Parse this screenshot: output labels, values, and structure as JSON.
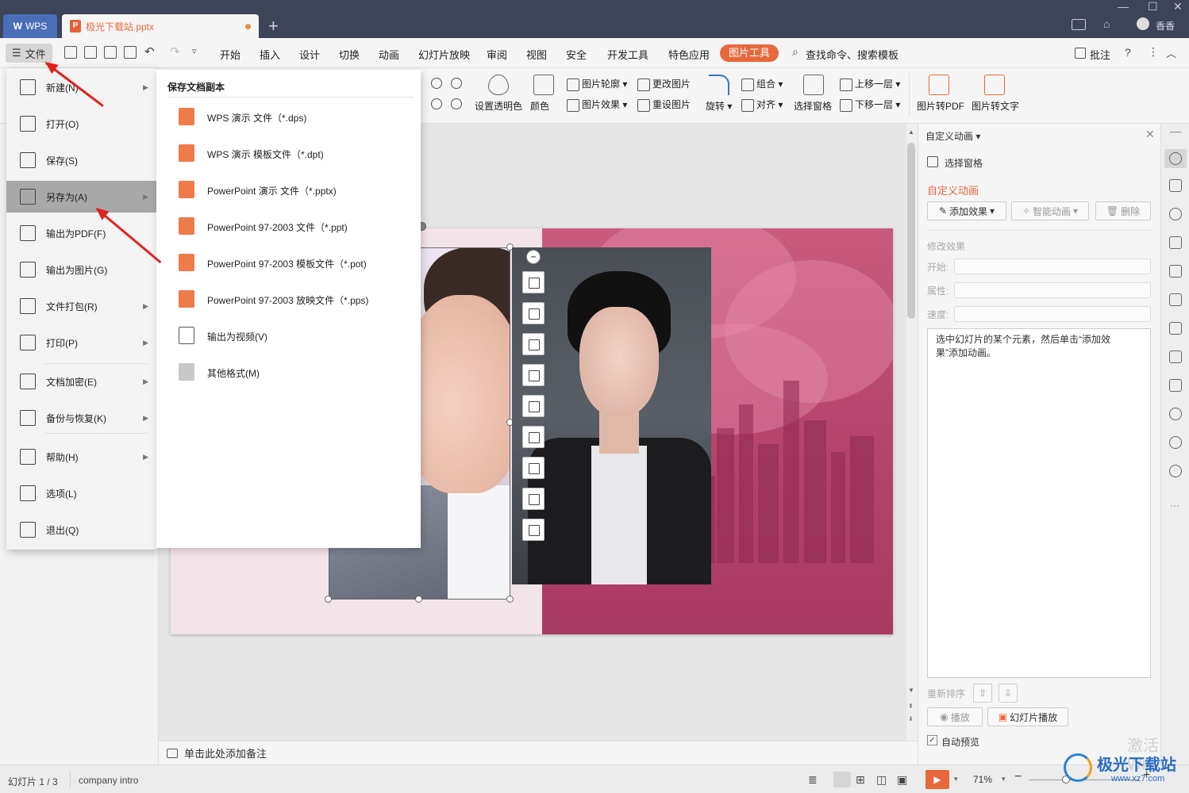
{
  "titlebar": {
    "app_tab": "WPS",
    "doc_tab": "极光下载站.pptx",
    "user": "香香"
  },
  "menubar": {
    "file": "文件",
    "items": [
      "开始",
      "插入",
      "设计",
      "切换",
      "动画",
      "幻灯片放映",
      "审阅",
      "视图",
      "安全",
      "开发工具",
      "特色应用"
    ],
    "active_tool_tab": "图片工具",
    "search": "查找命令、搜索模板",
    "comment": "批注"
  },
  "ribbon": {
    "set_transparent": "设置透明色",
    "color": "颜色",
    "picture_outline": "图片轮廓",
    "picture_effect": "图片效果",
    "change_picture": "更改图片",
    "reset_picture": "重设图片",
    "rotate": "旋转",
    "group": "组合",
    "align": "对齐",
    "select_pane": "选择窗格",
    "bring_forward": "上移一层",
    "send_backward": "下移一层",
    "pic_to_pdf": "图片转PDF",
    "pic_to_text": "图片转文字"
  },
  "file_menu": {
    "items": [
      {
        "label": "新建(N)",
        "arrow": true,
        "icon": "new-file-icon"
      },
      {
        "label": "打开(O)",
        "arrow": false,
        "icon": "open-folder-icon"
      },
      {
        "label": "保存(S)",
        "arrow": false,
        "icon": "save-icon"
      },
      {
        "label": "另存为(A)",
        "arrow": true,
        "icon": "save-as-icon"
      },
      {
        "label": "输出为PDF(F)",
        "arrow": false,
        "icon": "pdf-icon"
      },
      {
        "label": "输出为图片(G)",
        "arrow": false,
        "icon": "image-icon"
      },
      {
        "label": "文件打包(R)",
        "arrow": true,
        "icon": "package-icon"
      },
      {
        "label": "打印(P)",
        "arrow": true,
        "icon": "print-icon"
      },
      {
        "label": "文档加密(E)",
        "arrow": true,
        "icon": "encrypt-icon"
      },
      {
        "label": "备份与恢复(K)",
        "arrow": true,
        "icon": "backup-icon"
      },
      {
        "label": "帮助(H)",
        "arrow": true,
        "icon": "help-icon"
      },
      {
        "label": "选项(L)",
        "arrow": false,
        "icon": "gear-icon"
      },
      {
        "label": "退出(Q)",
        "arrow": false,
        "icon": "exit-icon"
      }
    ]
  },
  "save_as_submenu": {
    "title": "保存文档副本",
    "items": [
      {
        "label": "WPS 演示 文件（*.dps)",
        "icon": "dps-file-icon"
      },
      {
        "label": "WPS 演示 模板文件（*.dpt)",
        "icon": "dpt-file-icon"
      },
      {
        "label": "PowerPoint 演示 文件（*.pptx)",
        "icon": "pptx-file-icon"
      },
      {
        "label": "PowerPoint 97-2003 文件（*.ppt)",
        "icon": "ppt-file-icon"
      },
      {
        "label": "PowerPoint 97-2003 模板文件（*.pot)",
        "icon": "pot-file-icon"
      },
      {
        "label": "PowerPoint 97-2003 放映文件（*.pps)",
        "icon": "pps-file-icon"
      },
      {
        "label": "输出为视频(V)",
        "icon": "video-icon"
      },
      {
        "label": "其他格式(M)",
        "icon": "other-format-icon"
      }
    ]
  },
  "notes": {
    "placeholder": "单击此处添加备注"
  },
  "status": {
    "slide_counter": "幻灯片 1 / 3",
    "theme": "company intro",
    "zoom": "71%"
  },
  "right_panel": {
    "title": "自定义动画",
    "select_pane": "选择窗格",
    "section_title": "自定义动画",
    "add_effect": "添加效果",
    "smart_animation": "智能动画",
    "delete": "删除",
    "modify_effect": "修改效果",
    "start": "开始:",
    "property": "属性:",
    "speed": "速度:",
    "hint": "选中幻灯片的某个元素，然后单击“添加效果”添加动画。",
    "reorder": "重新排序",
    "play": "播放",
    "slideshow": "幻灯片播放",
    "auto_preview": "自动预览",
    "watermark": "激活 Win"
  },
  "brand": {
    "name": "极光下载站",
    "url": "www.xz7.com"
  },
  "colors": {
    "accent": "#e8683c",
    "annotation_arrow": "#e0221f",
    "title_bar": "#3d4457"
  }
}
